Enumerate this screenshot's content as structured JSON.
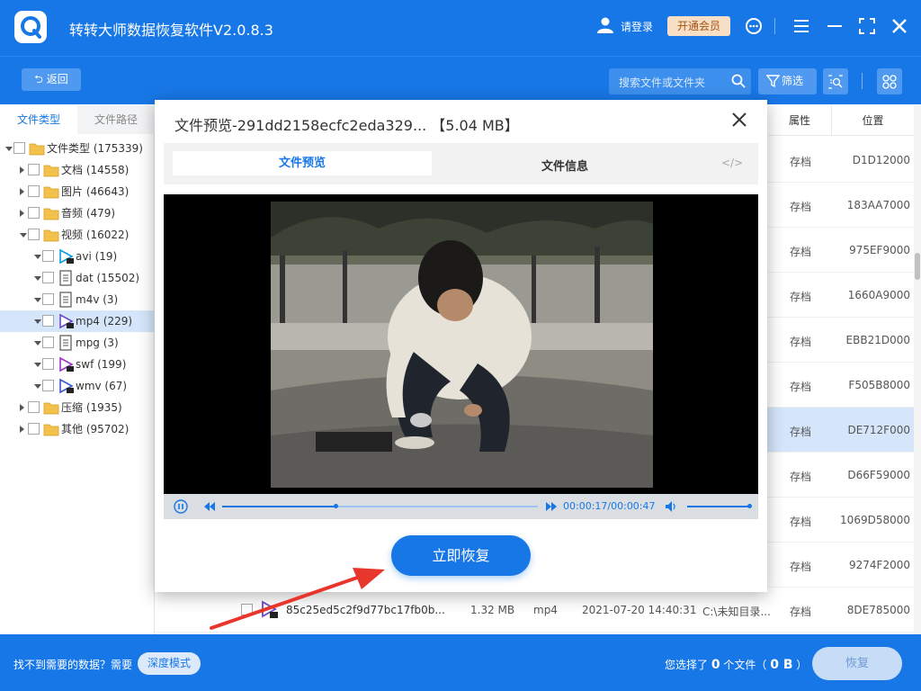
{
  "app": {
    "title": "转转大师数据恢复软件V2.0.8.3",
    "login": "请登录",
    "vip": "开通会员"
  },
  "toolbar": {
    "back": "返回",
    "search_placeholder": "搜索文件或文件夹",
    "filter": "筛选"
  },
  "sidebar": {
    "tabs": [
      "文件类型",
      "文件路径"
    ],
    "tree": [
      {
        "label": "文件类型 (175339)",
        "level": 0,
        "expand": "down",
        "icon": "folder-icon"
      },
      {
        "label": "文档 (14558)",
        "level": 1,
        "expand": "right",
        "icon": "folder-icon"
      },
      {
        "label": "图片 (46643)",
        "level": 1,
        "expand": "right",
        "icon": "folder-icon"
      },
      {
        "label": "音频 (479)",
        "level": 1,
        "expand": "right",
        "icon": "folder-icon"
      },
      {
        "label": "视频 (16022)",
        "level": 1,
        "expand": "down",
        "icon": "folder-icon"
      },
      {
        "label": "avi (19)",
        "level": 2,
        "expand": "down",
        "icon": "avi-icon"
      },
      {
        "label": "dat (15502)",
        "level": 2,
        "expand": "down",
        "icon": "dat-icon"
      },
      {
        "label": "m4v (3)",
        "level": 2,
        "expand": "down",
        "icon": "m4v-icon"
      },
      {
        "label": "mp4 (229)",
        "level": 2,
        "expand": "down",
        "icon": "mp4-icon",
        "selected": true
      },
      {
        "label": "mpg (3)",
        "level": 2,
        "expand": "down",
        "icon": "mpg-icon"
      },
      {
        "label": "swf (199)",
        "level": 2,
        "expand": "down",
        "icon": "swf-icon"
      },
      {
        "label": "wmv (67)",
        "level": 2,
        "expand": "down",
        "icon": "wmv-icon"
      },
      {
        "label": "压缩 (1935)",
        "level": 1,
        "expand": "right",
        "icon": "folder-icon"
      },
      {
        "label": "其他 (95702)",
        "level": 1,
        "expand": "right",
        "icon": "folder-icon"
      }
    ]
  },
  "table": {
    "headers": {
      "attr": "属性",
      "location": "位置"
    },
    "rows": [
      {
        "attr": "存档",
        "loc": "D1D12000"
      },
      {
        "attr": "存档",
        "loc": "183AA7000"
      },
      {
        "attr": "存档",
        "loc": "975EF9000"
      },
      {
        "attr": "存档",
        "loc": "1660A9000"
      },
      {
        "attr": "存档",
        "loc": "EBB21D000"
      },
      {
        "attr": "存档",
        "loc": "F505B8000"
      },
      {
        "attr": "存档",
        "loc": "DE712F000",
        "highlight": true
      },
      {
        "attr": "存档",
        "loc": "D66F59000"
      },
      {
        "attr": "存档",
        "loc": "1069D58000"
      },
      {
        "attr": "存档",
        "loc": "9274F2000"
      },
      {
        "attr": "存档",
        "loc": "8DE785000",
        "name": "85c25ed5c2f9d77bc17fb0b...",
        "size": "1.32 MB",
        "type": "mp4",
        "date": "2021-07-20 14:40:31",
        "path": "C:\\未知目录..."
      }
    ]
  },
  "bottom": {
    "nofind": "找不到需要的数据？需要",
    "deep": "深度模式",
    "sel_prefix": "您选择了",
    "sel_count": "0",
    "sel_mid": "个文件（",
    "sel_size": "0 B",
    "sel_suffix": "）",
    "recover": "恢复"
  },
  "modal": {
    "title": "文件预览-291dd2158ecfc2eda329... 【5.04 MB】",
    "tab_preview": "文件预览",
    "tab_info": "文件信息",
    "code": "</>",
    "time": "00:00:17/00:00:47",
    "progress": 0.36,
    "volume": 1.0,
    "recover": "立即恢复"
  }
}
